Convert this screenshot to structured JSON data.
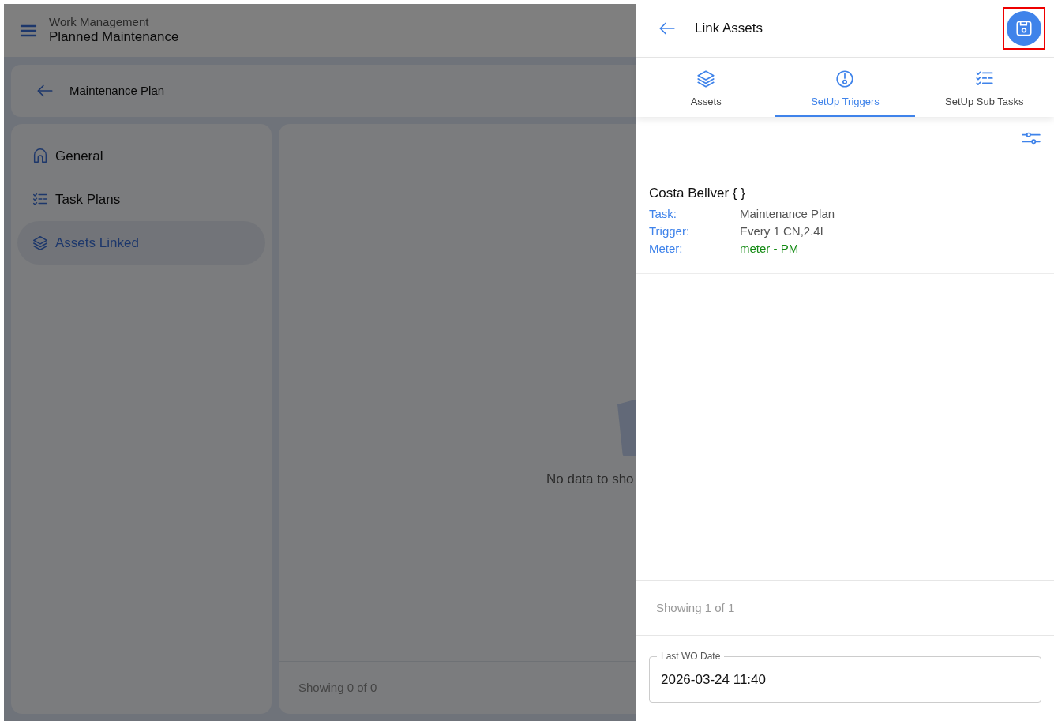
{
  "app": {
    "header": {
      "subtitle": "Work Management",
      "title": "Planned Maintenance"
    },
    "breadcrumb": {
      "title": "Maintenance Plan"
    },
    "sidebar": {
      "items": [
        {
          "label": "General",
          "kind": "home",
          "selected": false
        },
        {
          "label": "Task Plans",
          "kind": "checklist",
          "selected": false
        },
        {
          "label": "Assets Linked",
          "kind": "layers",
          "selected": true
        }
      ]
    },
    "empty_state": {
      "message": "No data to sho"
    },
    "footer": {
      "text": "Showing 0 of 0"
    }
  },
  "panel": {
    "title": "Link Assets",
    "tabs": [
      {
        "label": "Assets",
        "kind": "layers",
        "selected": false
      },
      {
        "label": "SetUp Triggers",
        "kind": "trigger",
        "selected": true
      },
      {
        "label": "SetUp Sub Tasks",
        "kind": "checklist",
        "selected": false
      }
    ],
    "records": [
      {
        "name": "Costa Bellver { }",
        "fields": [
          {
            "label": "Task:",
            "value": "Maintenance Plan",
            "color": "#555555"
          },
          {
            "label": "Trigger:",
            "value": "Every 1 CN,2.4L",
            "color": "#555555"
          },
          {
            "label": "Meter:",
            "value": "meter - PM",
            "color": "#138a13"
          }
        ]
      }
    ],
    "pagination": {
      "text": "Showing 1 of 1"
    },
    "date_field": {
      "label": "Last WO Date",
      "value": "2026-03-24 11:40"
    }
  }
}
